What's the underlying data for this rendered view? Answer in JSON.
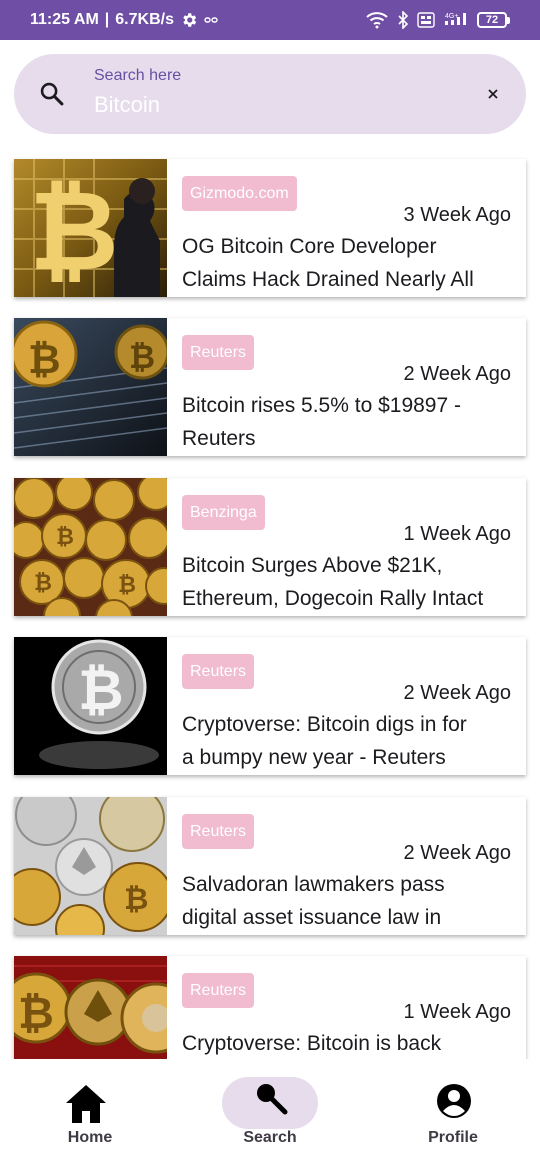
{
  "status_bar": {
    "time": "11:25 AM",
    "speed": "6.7KB/s",
    "battery": "72",
    "network_label": "4G+"
  },
  "search": {
    "placeholder": "Search here",
    "value": "Bitcoin"
  },
  "articles": [
    {
      "source": "Gizmodo.com",
      "age": "3 Week Ago",
      "title_line1": "OG Bitcoin Core Developer",
      "title_line2": "Claims Hack Drained Nearly All"
    },
    {
      "source": "Reuters",
      "age": "2 Week Ago",
      "title_line1": "Bitcoin rises 5.5% to $19897 -",
      "title_line2": "Reuters"
    },
    {
      "source": "Benzinga",
      "age": "1 Week Ago",
      "title_line1": "Bitcoin Surges Above $21K,",
      "title_line2": "Ethereum, Dogecoin Rally Intact"
    },
    {
      "source": "Reuters",
      "age": "2 Week Ago",
      "title_line1": "Cryptoverse: Bitcoin digs in for",
      "title_line2": "a bumpy new year - Reuters"
    },
    {
      "source": "Reuters",
      "age": "2 Week Ago",
      "title_line1": "Salvadoran lawmakers pass",
      "title_line2": "digital asset issuance law in"
    },
    {
      "source": "Reuters",
      "age": "1 Week Ago",
      "title_line1": "Cryptoverse: Bitcoin is back",
      "title_line2": ""
    }
  ],
  "nav": {
    "home": "Home",
    "search": "Search",
    "profile": "Profile",
    "active": "search"
  },
  "colors": {
    "status_bar": "#6f4ea5",
    "search_bg": "#e6dcec",
    "source_badge": "#f1bcd0",
    "placeholder": "#6750a4"
  }
}
